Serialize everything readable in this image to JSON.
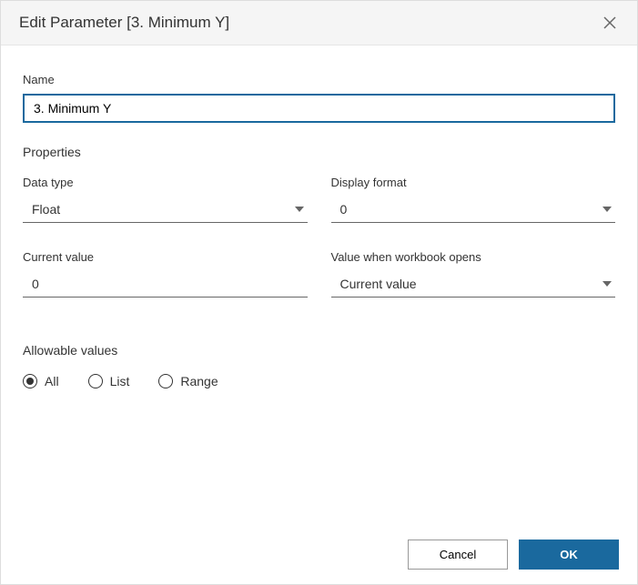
{
  "header": {
    "title": "Edit Parameter [3. Minimum Y]"
  },
  "name": {
    "label": "Name",
    "value": "3. Minimum Y"
  },
  "properties": {
    "label": "Properties",
    "data_type": {
      "label": "Data type",
      "value": "Float"
    },
    "display_format": {
      "label": "Display format",
      "value": "0"
    },
    "current_value": {
      "label": "Current value",
      "value": "0"
    },
    "value_on_open": {
      "label": "Value when workbook opens",
      "value": "Current value"
    }
  },
  "allowable": {
    "label": "Allowable values",
    "options": {
      "all": "All",
      "list": "List",
      "range": "Range"
    }
  },
  "footer": {
    "cancel": "Cancel",
    "ok": "OK"
  }
}
